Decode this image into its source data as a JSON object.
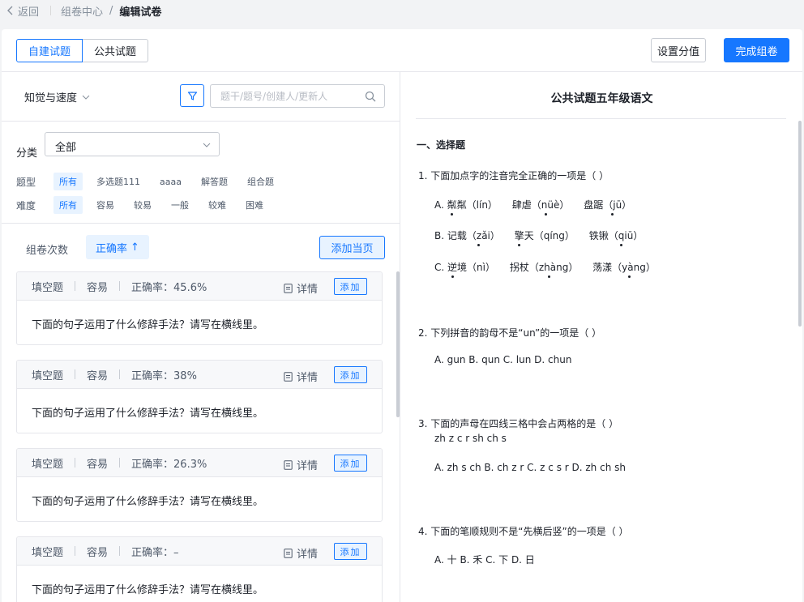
{
  "breadcrumb": {
    "back": "返回",
    "parent": "组卷中心",
    "slash": "/",
    "current": "编辑试卷"
  },
  "header": {
    "tabs": [
      "自建试题",
      "公共试题"
    ],
    "set_score": "设置分值",
    "finish": "完成组卷"
  },
  "left": {
    "knowledge": "知觉与速度",
    "search_placeholder": "题干/题号/创建人/更新人",
    "category_label": "分类",
    "category_value": "全部",
    "type_label": "题型",
    "types": [
      "所有",
      "多选题111",
      "aaaa",
      "解答题",
      "组合题"
    ],
    "difficulty_label": "难度",
    "difficulties": [
      "所有",
      "容易",
      "较易",
      "一般",
      "较难",
      "困难"
    ],
    "sort_count": "组卷次数",
    "sort_rate": "正确率",
    "sort_arrow": "↑",
    "add_page": "添加当页",
    "detail_label": "详情",
    "add_label": "添加",
    "questions": [
      {
        "type": "填空题",
        "difficulty": "容易",
        "rate": "正确率：45.6%",
        "text": "下面的句子运用了什么修辞手法？请写在横线里。"
      },
      {
        "type": "填空题",
        "difficulty": "容易",
        "rate": "正确率：38%",
        "text": "下面的句子运用了什么修辞手法？请写在横线里。"
      },
      {
        "type": "填空题",
        "difficulty": "容易",
        "rate": "正确率：26.3%",
        "text": "下面的句子运用了什么修辞手法？请写在横线里。"
      },
      {
        "type": "填空题",
        "difficulty": "容易",
        "rate": "正确率：–",
        "text": "下面的句子运用了什么修辞手法？请写在横线里。"
      }
    ]
  },
  "paper": {
    "title": "公共试题五年级语文",
    "section": "一、选择题",
    "q1": {
      "stem": "1.  下面加点字的注音完全正确的一项是（     ）",
      "a": {
        "label": "A.",
        "w1a": "粼",
        "w1b": "粼（lín）",
        "w2a": "肆",
        "w2b": "虐（nüè）",
        "w3a": "盘",
        "w3b": "踞（jū）"
      },
      "b": {
        "label": "B.",
        "w1a": "记",
        "w1b": "载（zǎi）",
        "w2a": "擎",
        "w2b": "天（qíng）",
        "w3a": "铁",
        "w3b": "锹（qiū）"
      },
      "c": {
        "label": "C.",
        "w1a": "逆",
        "w1b": "境（nì）",
        "w2a": "拐",
        "w2b": "杖（zhàng）",
        "w3a": "荡",
        "w3b": "漾（yàng）"
      }
    },
    "q2": {
      "stem": "2.  下列拼音的韵母不是“un”的一项是（     ）",
      "options": "A.  gun     B.  qun     C.  lun     D.  chun"
    },
    "q3": {
      "stem": "3.  下面的声母在四线三格中会占两格的是（     ）",
      "sub": "zh  z  c  r  sh  ch  s",
      "options": "A.  zh  s  ch     B.  ch  z  r     C.  z  c  s  r     D.  zh  ch  sh"
    },
    "q4": {
      "stem": "4.  下面的笔顺规则不是“先横后竖”的一项是（     ）",
      "options": "A.  十     B.  禾     C.  下     D.  日"
    }
  }
}
